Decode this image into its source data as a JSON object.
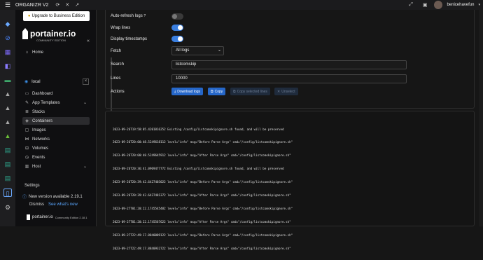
{
  "topbar": {
    "app_title": "ORGANIZR V2",
    "username": "benicehavefun"
  },
  "sidebar": {
    "upgrade_label": "Upgrade to Business Edition",
    "logo_name": "portainer.io",
    "logo_sub": "COMMUNITY EDITION",
    "home_label": "Home",
    "env_name": "local",
    "items": [
      {
        "label": "Dashboard"
      },
      {
        "label": "App Templates"
      },
      {
        "label": "Stacks"
      },
      {
        "label": "Containers"
      },
      {
        "label": "Images"
      },
      {
        "label": "Networks"
      },
      {
        "label": "Volumes"
      },
      {
        "label": "Events"
      },
      {
        "label": "Host"
      }
    ],
    "settings_label": "Settings",
    "update_text": "New version available 2.19.1",
    "dismiss_label": "Dismiss",
    "whats_new_label": "See what's new",
    "footer_brand": "portainer.io",
    "footer_version": "Community Edition 2.18.1"
  },
  "form": {
    "auto_refresh_label": "Auto-refresh logs",
    "wrap_lines_label": "Wrap lines",
    "display_timestamps_label": "Display timestamps",
    "fetch_label": "Fetch",
    "fetch_value": "All logs",
    "search_label": "Search",
    "search_value": "listcomskip",
    "lines_label": "Lines",
    "lines_value": "10000",
    "actions_label": "Actions",
    "download_label": "Download logs",
    "copy_label": "Copy",
    "copy_selected_label": "Copy selected lines",
    "unselect_label": "Unselect",
    "auto_refresh": false,
    "wrap_lines": true,
    "display_timestamps": true
  },
  "logs": {
    "lines": [
      "2023-09-26T19:58:05.4201816252 Existing /config/listcomskipignore.sh found, and will be preserved",
      "2023-09-26T20:00:48.5249618112 level=\"info\" msg=\"Before Parse Args\" cmd=\"/config/listcomskipignore.sh\"",
      "2023-09-26T20:00:48.5249645912 level=\"info\" msg=\"After Parse Args\" cmd=\"/config/listcomskipignore.sh\"",
      "2023-09-26T20:36:41.0969477772 Existing /config/listcomskipignore.sh found, and will be preserved",
      "2023-09-26T20:39:42.6427403022 level=\"info\" msg=\"Before Parse Args\" cmd=\"/config/listcomskipignore.sh\"",
      "2023-09-26T20:39:42.6427481372 level=\"info\" msg=\"After Parse Args\" cmd=\"/config/listcomskipignore.sh\"",
      "2023-09-27T01:20:22.1745545482 level=\"info\" msg=\"Before Parse Args\" cmd=\"/config/listcomskipignore.sh\"",
      "2023-09-27T01:20:22.1745567622 level=\"info\" msg=\"After Parse Args\" cmd=\"/config/listcomskipignore.sh\"",
      "2023-09-27T22:49:17.8840089122 level=\"info\" msg=\"Before Parse Args\" cmd=\"/config/listcomskipignore.sh\"",
      "2023-09-27T22:49:17.8840932722 level=\"info\" msg=\"After Parse Args\" cmd=\"/config/listcomskipignore.sh\""
    ]
  },
  "colors": {
    "accent": "#2667c9",
    "toggle_on": "#3a7fe0",
    "link": "#5aa7ff"
  }
}
